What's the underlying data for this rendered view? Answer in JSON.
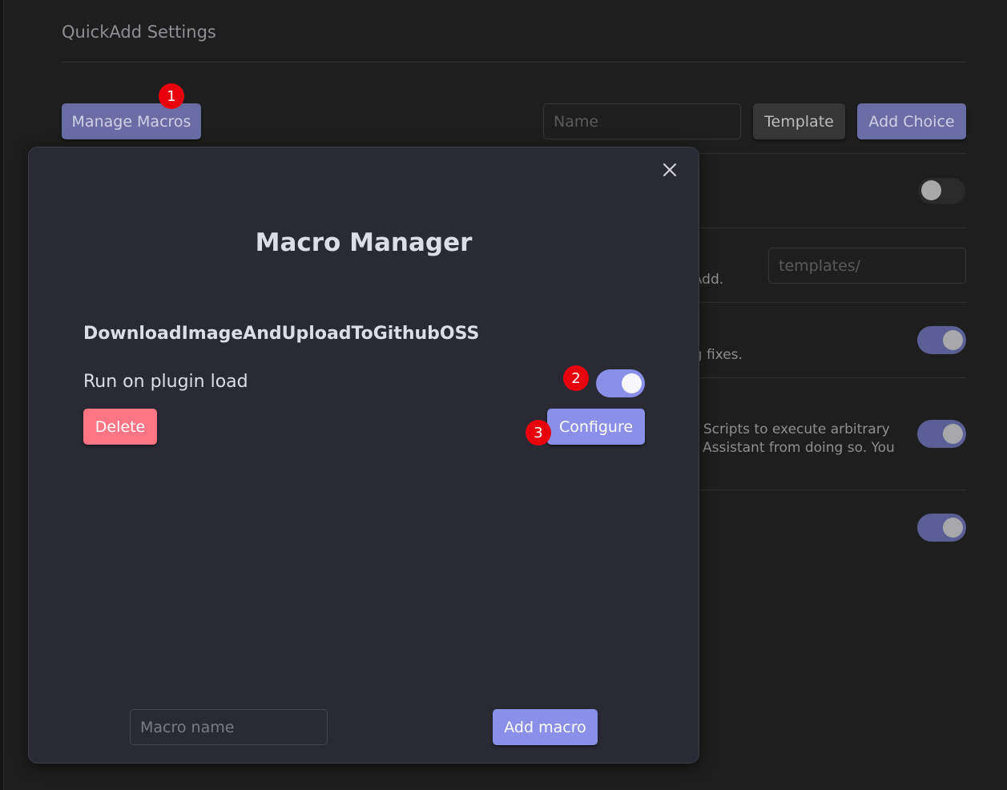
{
  "settings": {
    "title": "QuickAdd Settings",
    "manage_macros_label": "Manage Macros",
    "name_placeholder": "Name",
    "template_label": "Template",
    "add_choice_label": "Add Choice",
    "template_folder_placeholder": "templates/",
    "row_texts": [
      "kAdd.",
      "ug fixes.",
      "er Scripts to execute arbitrary",
      "AI Assistant from doing so. You"
    ]
  },
  "badges": [
    "1",
    "2",
    "3"
  ],
  "modal": {
    "title": "Macro Manager",
    "macro_name": "DownloadImageAndUploadToGithubOSS",
    "run_on_load_label": "Run on plugin load",
    "run_on_load_enabled": true,
    "delete_label": "Delete",
    "configure_label": "Configure",
    "macro_name_placeholder": "Macro name",
    "add_macro_label": "Add macro"
  },
  "colors": {
    "accent": "#8a8fe8",
    "danger": "#fb7585",
    "badge": "#e8000d"
  }
}
